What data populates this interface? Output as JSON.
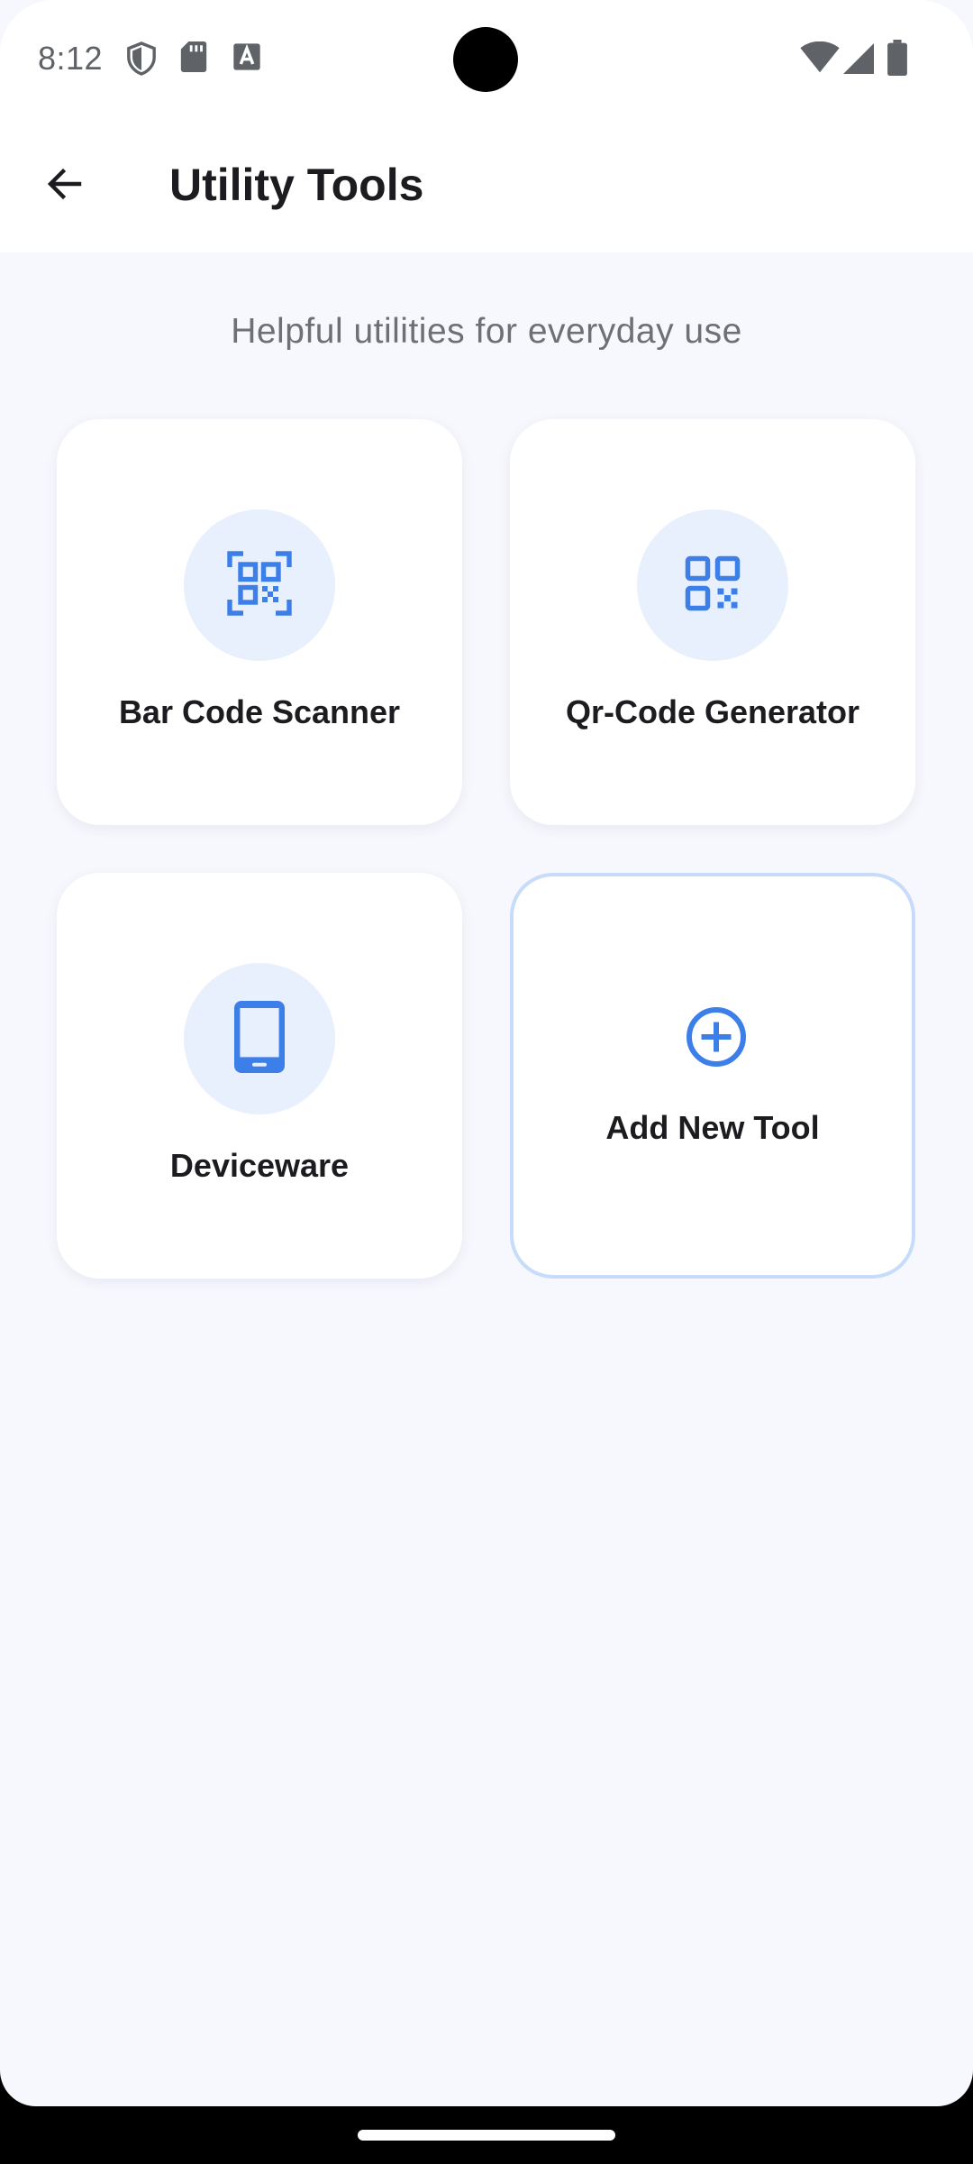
{
  "status_bar": {
    "time": "8:12",
    "left_icons": [
      "shield-icon",
      "sd-card-icon",
      "font-download-icon"
    ],
    "right_icons": [
      "wifi-icon",
      "cellular-signal-icon",
      "battery-icon"
    ]
  },
  "app_bar": {
    "back_icon": "arrow-back-icon",
    "title": "Utility Tools"
  },
  "main": {
    "subtitle": "Helpful utilities for everyday use",
    "tools": [
      {
        "label": "Bar Code Scanner",
        "icon": "qr-scanner-icon"
      },
      {
        "label": "Qr-Code Generator",
        "icon": "qr-code-icon"
      },
      {
        "label": "Deviceware",
        "icon": "smartphone-icon"
      }
    ],
    "add_tool": {
      "label": "Add New Tool",
      "icon": "add-circle-icon"
    }
  },
  "colors": {
    "accent": "#3D7FE8",
    "icon_background": "#E8F0FD",
    "page_background": "#F7F8FD",
    "add_card_border": "#C6DCFA"
  }
}
